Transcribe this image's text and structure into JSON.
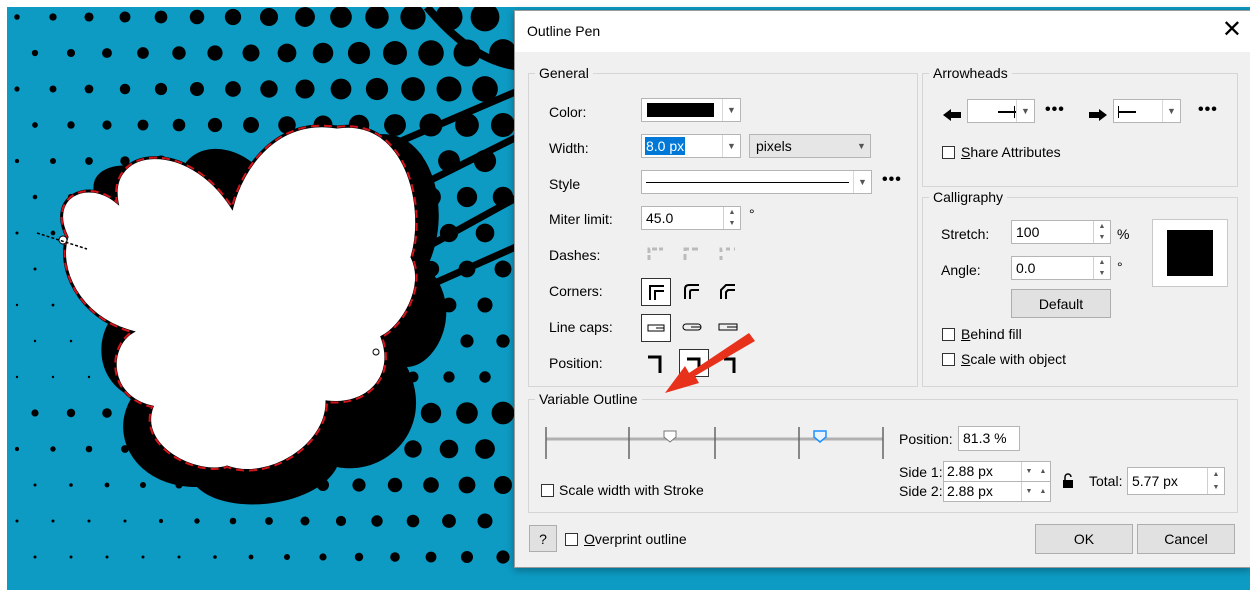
{
  "dialog": {
    "title": "Outline Pen",
    "close_glyph": "✕",
    "general": {
      "legend": "General",
      "color_label": "Color:",
      "color_value": "#000000",
      "width_label": "Width:",
      "width_value": "8.0 px",
      "units_value": "pixels",
      "style_label": "Style",
      "miter_label": "Miter limit:",
      "miter_value": "45.0",
      "miter_unit": "°",
      "dashes_label": "Dashes:",
      "corners_label": "Corners:",
      "linecaps_label": "Line caps:",
      "position_label": "Position:"
    },
    "arrowheads": {
      "legend": "Arrowheads",
      "share_prefix": "S",
      "share_rest": "hare Attributes"
    },
    "calligraphy": {
      "legend": "Calligraphy",
      "stretch_label": "Stretch:",
      "stretch_value": "100",
      "stretch_unit": "%",
      "angle_label": "Angle:",
      "angle_value": "0.0",
      "angle_unit": "°",
      "default_button": "Default",
      "behind_prefix": "B",
      "behind_rest": "ehind fill",
      "scale_prefix": "S",
      "scale_rest": "cale with object"
    },
    "variable_outline": {
      "legend": "Variable Outline",
      "position_label": "Position:",
      "position_value": "81.3 %",
      "side1_label": "Side 1:",
      "side1_value": "2.88 px",
      "side2_label": "Side 2:",
      "side2_value": "2.88 px",
      "total_label": "Total:",
      "total_value": "5.77 px",
      "scale_width_label": "Scale width with Stroke"
    },
    "footer": {
      "help_label": "?",
      "overprint_prefix": "O",
      "overprint_rest": "verprint outline",
      "ok_label": "OK",
      "cancel_label": "Cancel"
    }
  },
  "colors": {
    "canvas_background": "#0d9bc4",
    "annotation_arrow": "#e8311b",
    "dash_line": "#d4141b",
    "slider_active_handle": "#1e90ff"
  },
  "icons": {
    "left_arrowhead": "arrowhead-left-icon",
    "right_arrowhead": "arrowhead-right-icon",
    "lock": "lock-icon",
    "more": "ellipsis-icon"
  }
}
